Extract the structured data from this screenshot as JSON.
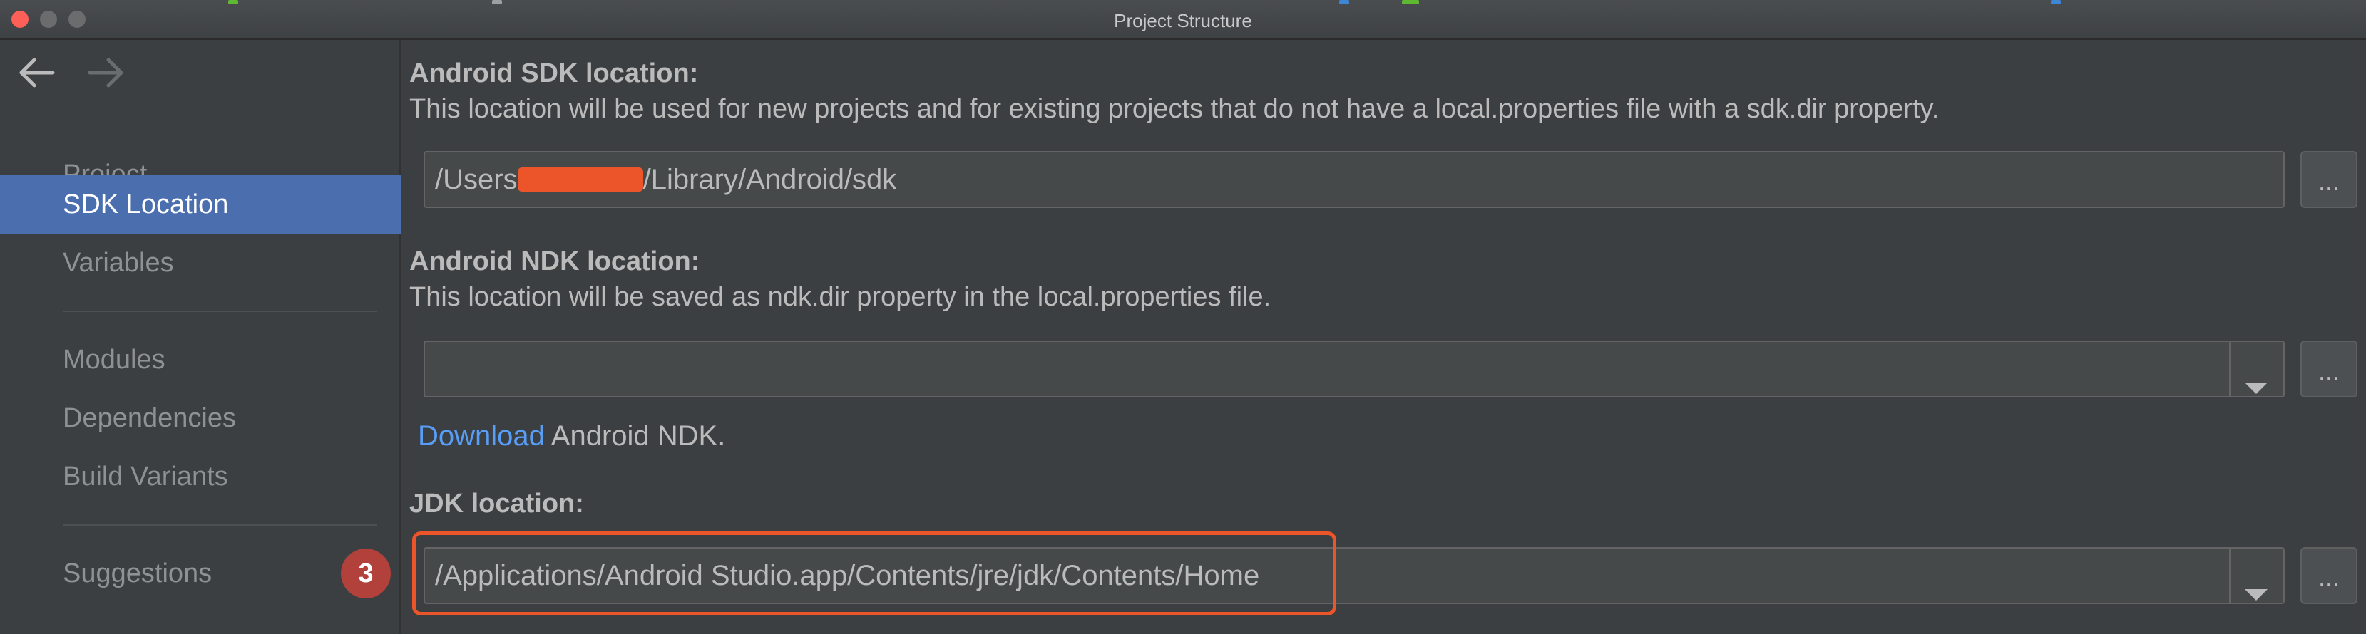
{
  "window": {
    "title": "Project Structure"
  },
  "colors": {
    "accent": "#4b6eaf",
    "link": "#589df6",
    "highlight": "#eb5529",
    "badge": "#b2403b"
  },
  "sidebar": {
    "items": [
      {
        "label": "Project"
      },
      {
        "label": "SDK Location"
      },
      {
        "label": "Variables"
      },
      {
        "label": "Modules"
      },
      {
        "label": "Dependencies"
      },
      {
        "label": "Build Variants"
      },
      {
        "label": "Suggestions",
        "badge": "3"
      }
    ],
    "selected": "SDK Location"
  },
  "sdk": {
    "heading": "Android SDK location:",
    "description": "This location will be used for new projects and for existing projects that do not have a local.properties file with a sdk.dir property.",
    "path_prefix": "/Users",
    "path_suffix": "/Library/Android/sdk",
    "browse_label": "..."
  },
  "ndk": {
    "heading": "Android NDK location:",
    "description": "This location will be saved as ndk.dir property in the local.properties file.",
    "value": "",
    "browse_label": "...",
    "download_link": "Download",
    "download_text": " Android NDK."
  },
  "jdk": {
    "heading": "JDK location:",
    "value": "/Applications/Android Studio.app/Contents/jre/jdk/Contents/Home",
    "browse_label": "..."
  }
}
